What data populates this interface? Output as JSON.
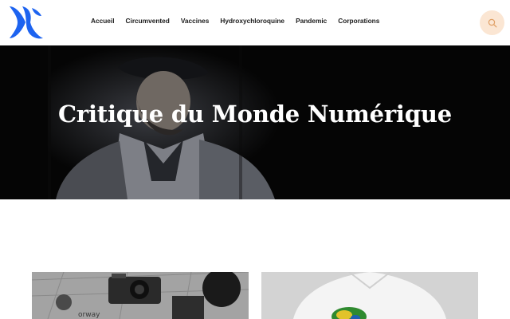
{
  "header": {
    "logo_icon": "blue-x-logo-icon",
    "nav": [
      {
        "label": "Accueil"
      },
      {
        "label": "Circumvented"
      },
      {
        "label": "Vaccines"
      },
      {
        "label": "Hydroxychloroquine"
      },
      {
        "label": "Pandemic"
      },
      {
        "label": "Corporations"
      }
    ],
    "search_icon": "search-icon"
  },
  "hero": {
    "title": "Critique du Monde Numérique"
  },
  "cards": [
    {
      "image": "vintage-camera-map-photo",
      "caption_fragment": "orway"
    },
    {
      "image": "white-shirt-globe-photo"
    }
  ],
  "colors": {
    "logo_blue": "#1d63f0",
    "search_bg": "#fbe6d3",
    "search_icon": "#e0a066",
    "nav_text": "#1b1b1b",
    "hero_bg": "#050505"
  }
}
